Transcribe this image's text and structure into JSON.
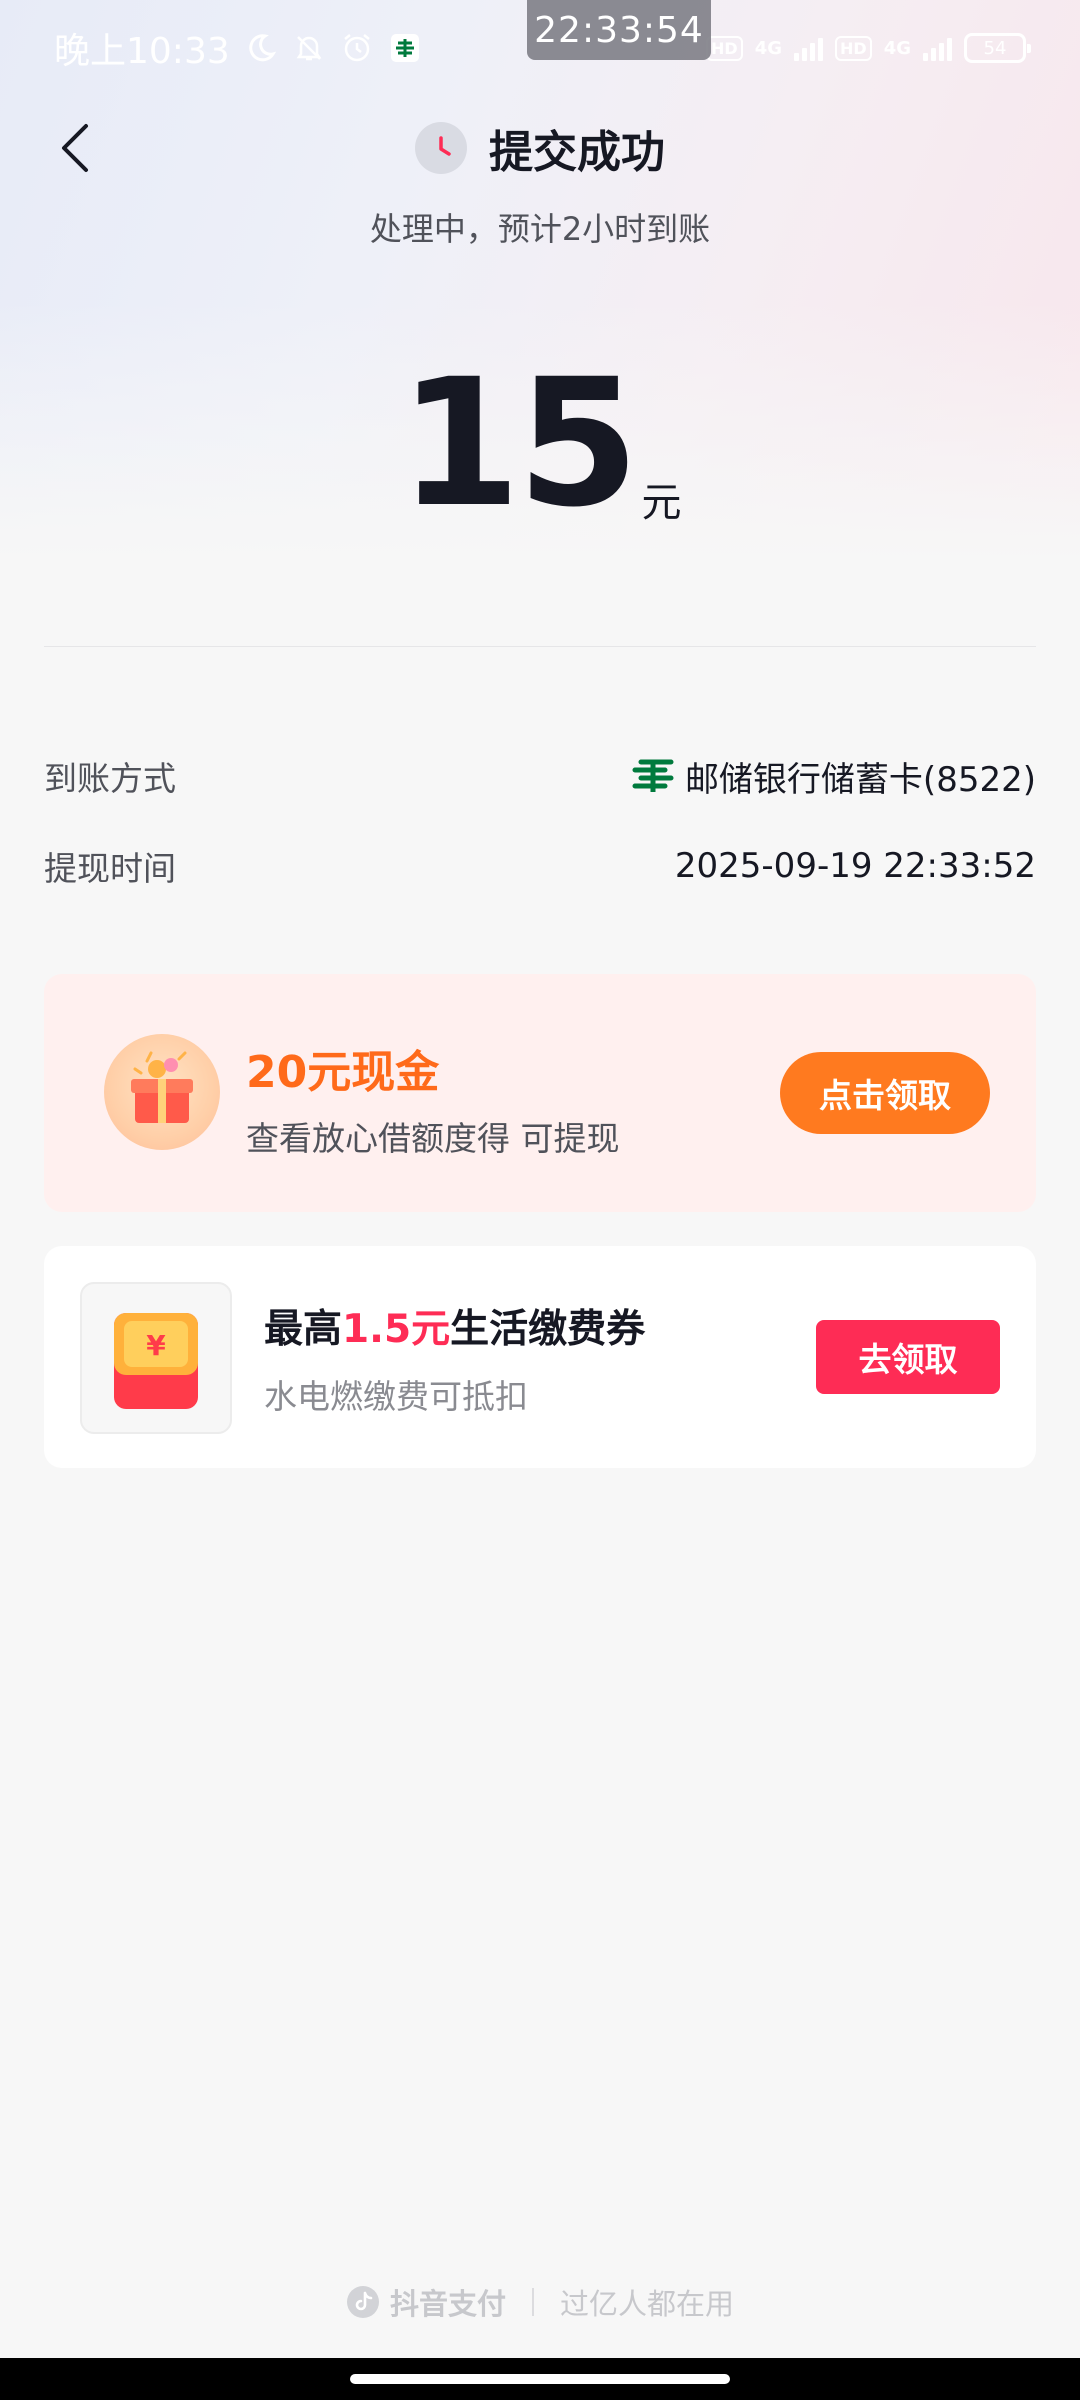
{
  "status_bar": {
    "time": "晚上10:33",
    "overlay_time": "22:33:54",
    "network_1": "4G",
    "network_2": "4G",
    "hd_1": "HD",
    "hd_2": "HD",
    "battery": "54"
  },
  "header": {
    "title": "提交成功",
    "subtitle": "处理中，预计2小时到账"
  },
  "amount": {
    "value": "15",
    "unit": "元"
  },
  "details": {
    "method_label": "到账方式",
    "method_value": "邮储银行储蓄卡(8522)",
    "time_label": "提现时间",
    "time_value": "2025-09-19 22:33:52"
  },
  "promo_cash": {
    "title": "20元现金",
    "subtitle": "查看放心借额度得 可提现",
    "button": "点击领取"
  },
  "promo_coupon": {
    "title_prefix": "最高",
    "title_highlight": "1.5元",
    "title_suffix": "生活缴费券",
    "subtitle": "水电燃缴费可抵扣",
    "button": "去领取",
    "thumb_symbol": "¥"
  },
  "footer": {
    "brand": "抖音支付",
    "slogan": "过亿人都在用"
  },
  "colors": {
    "accent_orange": "#ff7a1f",
    "accent_red": "#fe2c55",
    "bank_green": "#007a3d"
  }
}
